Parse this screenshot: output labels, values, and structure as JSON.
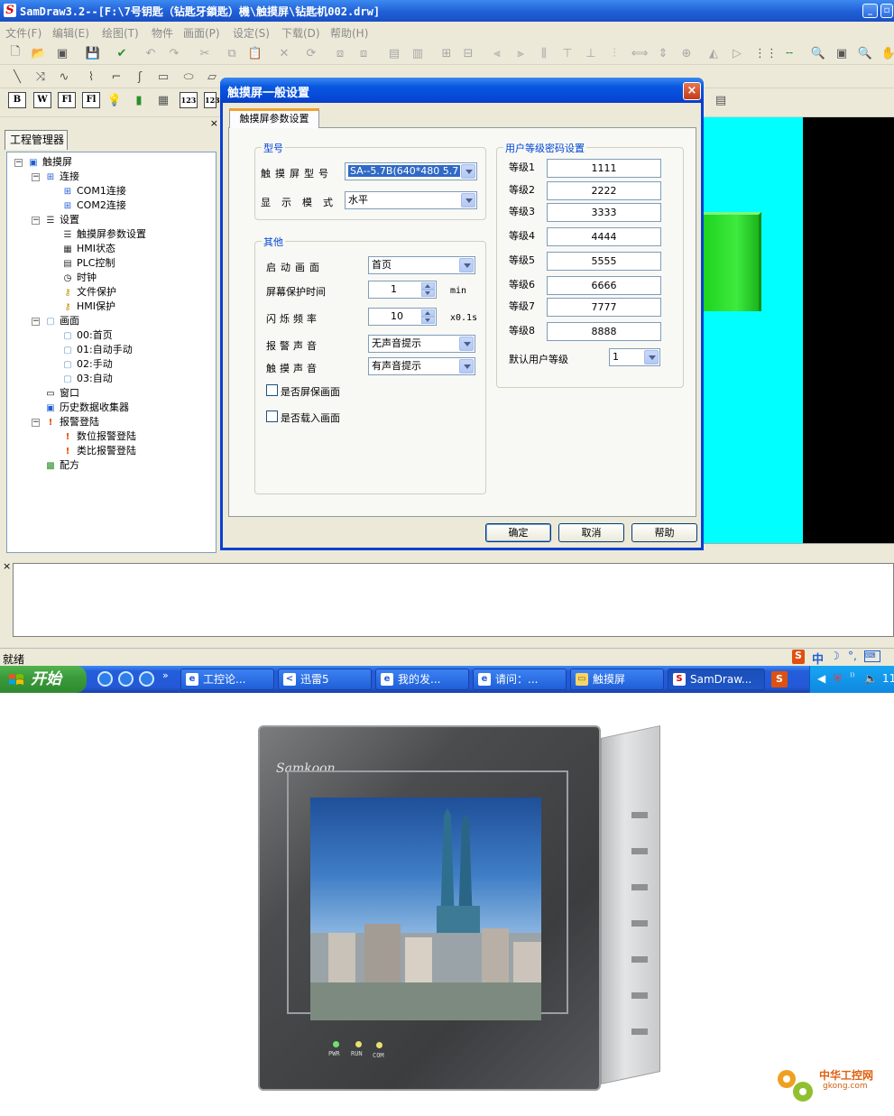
{
  "window": {
    "title": "SamDraw3.2--[F:\\7号钥匙（钻匙牙鎖匙）機\\触摸屏\\钻匙机002.drw]"
  },
  "menu": [
    "文件(F)",
    "编辑(E)",
    "绘图(T)",
    "物件",
    "画面(P)",
    "设定(S)",
    "下载(D)",
    "帮助(H)"
  ],
  "project_panel": {
    "tab": "工程管理器",
    "close": "×",
    "tree": {
      "root": "触摸屏",
      "connect": "连接",
      "com1": "COM1连接",
      "com2": "COM2连接",
      "settings": "设置",
      "param": "触摸屏参数设置",
      "hmi_state": "HMI状态",
      "plc": "PLC控制",
      "clock": "时钟",
      "file_prot": "文件保护",
      "hmi_prot": "HMI保护",
      "screens": "画面",
      "s0": "00:首页",
      "s1": "01:自动手动",
      "s2": "02:手动",
      "s3": "03:自动",
      "window": "窗口",
      "history": "历史数据收集器",
      "alarm": "报警登陆",
      "alarm_num": "数位报警登陆",
      "alarm_ana": "类比报警登陆",
      "recipe": "配方"
    }
  },
  "toolbar3": {
    "b": "B",
    "w": "W",
    "fl": "Fl",
    "n123": "123"
  },
  "dialog": {
    "title": "触摸屏一般设置",
    "close": "×",
    "tab": "触摸屏参数设置",
    "model_group": {
      "label": "型号",
      "model_label": "触摸屏型号",
      "model_value": "SA--5.7B(640*480  5.7",
      "mode_label": "显示模式",
      "mode_value": "水平"
    },
    "other_group": {
      "label": "其他",
      "start_label": "启动画面",
      "start_value": "首页",
      "saver_label": "屏幕保护时间",
      "saver_value": "1",
      "saver_unit": "min",
      "blink_label": "闪烁频率",
      "blink_value": "10",
      "blink_unit": "x0.1s",
      "alarm_label": "报警声音",
      "alarm_value": "无声音提示",
      "touch_label": "触摸声音",
      "touch_value": "有声音提示",
      "chk_saver": "是否屏保画面",
      "chk_load": "是否载入画面"
    },
    "password_group": {
      "label": "用户等级密码设置",
      "levels": [
        {
          "label": "等级1",
          "value": "1111"
        },
        {
          "label": "等级2",
          "value": "2222"
        },
        {
          "label": "等级3",
          "value": "3333"
        },
        {
          "label": "等级4",
          "value": "4444"
        },
        {
          "label": "等级5",
          "value": "5555"
        },
        {
          "label": "等级6",
          "value": "6666"
        },
        {
          "label": "等级7",
          "value": "7777"
        },
        {
          "label": "等级8",
          "value": "8888"
        }
      ],
      "default_label": "默认用户等级",
      "default_value": "1"
    },
    "ok": "确定",
    "cancel": "取消",
    "help": "帮助"
  },
  "output_panel": {
    "close": "×"
  },
  "status": {
    "text": "就绪"
  },
  "taskbar": {
    "start": "开始",
    "items": [
      "工控论...",
      "迅雷5",
      "我的发...",
      "请问：...",
      "触摸屏",
      "SamDraw..."
    ],
    "tray_ime": "中",
    "tray_time": "11"
  },
  "product": {
    "brand": "Samkoon",
    "led_pwr": "PWR",
    "led_run": "RUN",
    "led_com": "COM",
    "watermark": "中华工控网",
    "watermark_url": "gkong.com"
  },
  "colors": {
    "titlebar": "#0a58e0",
    "canvas": "#00ffff",
    "button_green": "#3eea3e",
    "group_label": "#0046d5"
  }
}
